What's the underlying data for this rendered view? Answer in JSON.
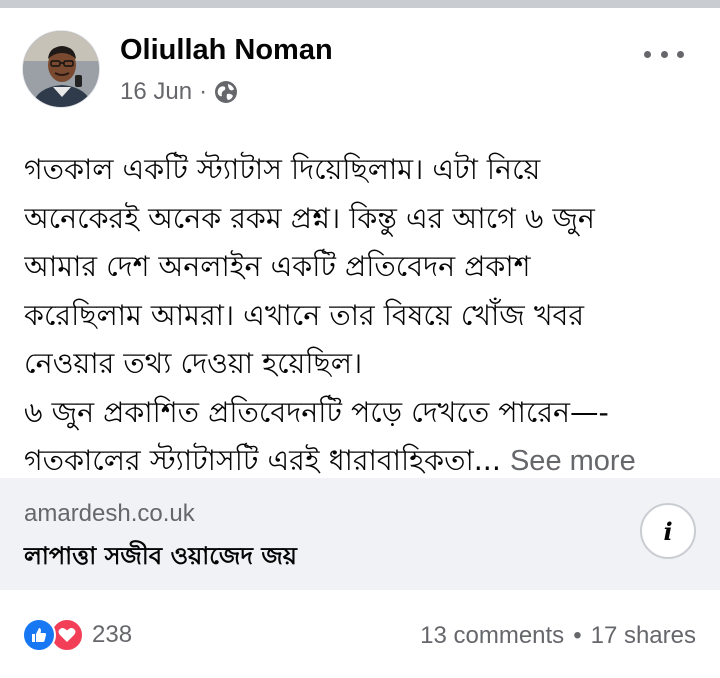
{
  "post": {
    "author": "Oliullah Noman",
    "date": "16 Jun",
    "date_separator": "·",
    "privacy_icon": "globe-icon",
    "more_icon": "more-horizontal-icon",
    "body_lines": [
      "গতকাল একটি স্ট্যাটাস দিয়েছিলাম। এটা নিয়ে",
      "অনেকেরই অনেক রকম প্রশ্ন। কিন্তু এর আগে ৬ জুন",
      "আমার দেশ অনলাইন একটি প্রতিবেদন প্রকাশ",
      "করেছিলাম আমরা। এখানে তার বিষয়ে খোঁজ খবর",
      "নেওয়ার তথ্য দেওয়া হয়েছিল।",
      "৬ জুন প্রকাশিত প্রতিবেদনটি পড়ে দেখতে পারেন—-",
      "গতকালের স্ট্যাটাসটি এরই ধারাবাহিকতা..."
    ],
    "see_more": "See more"
  },
  "link_preview": {
    "domain": "amardesh.co.uk",
    "title": "লাপাত্তা সজীব ওয়াজেদ জয়",
    "info_label": "i"
  },
  "footer": {
    "reaction_icons": [
      "like-icon",
      "love-icon"
    ],
    "reaction_count": "238",
    "comments": "13 comments",
    "separator": "•",
    "shares": "17 shares"
  },
  "colors": {
    "text_primary": "#050505",
    "text_secondary": "#65676b",
    "card_bg": "#f0f2f5",
    "like_blue": "#1877f2",
    "love_red": "#f33e58",
    "separator_bar": "#c9ccd1"
  }
}
